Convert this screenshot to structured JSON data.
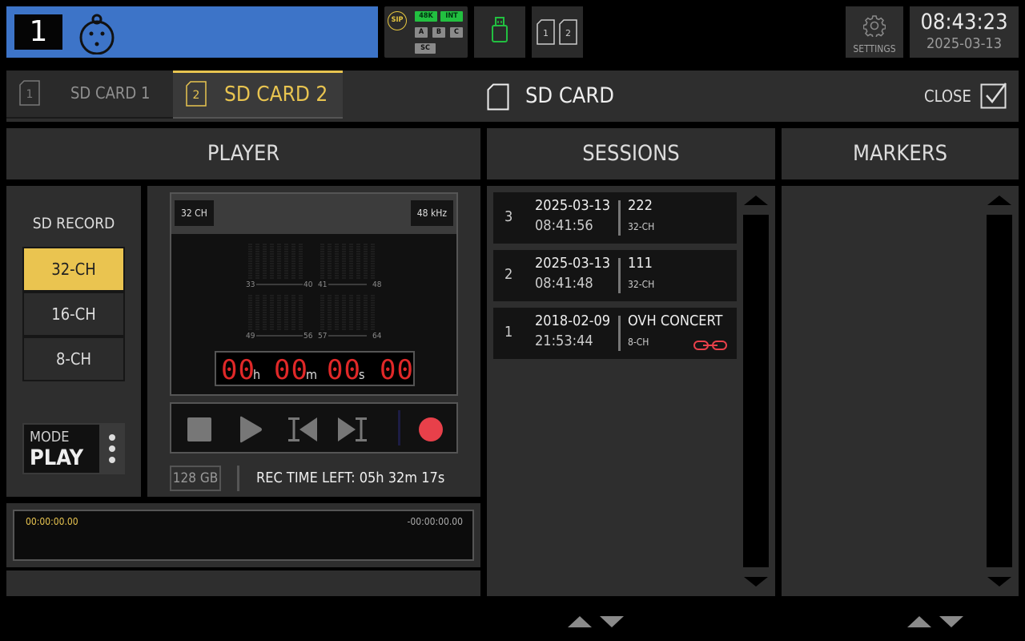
{
  "topbar": {
    "channel_number": "1",
    "status": {
      "sip": "SIP",
      "rate": "48K",
      "clock": "INT",
      "slots": [
        "A",
        "B",
        "C"
      ],
      "sc": "SC"
    },
    "sd_slots": [
      "1",
      "2"
    ],
    "settings_label": "SETTINGS",
    "clock_time": "08:43:23",
    "clock_date": "2025-03-13",
    "channel_color": "#3d74c8",
    "status_green": "#22c040"
  },
  "tabs": [
    {
      "number": "1",
      "label": "SD CARD 1",
      "active": false
    },
    {
      "number": "2",
      "label": "SD CARD 2",
      "active": true
    }
  ],
  "header": {
    "title": "SD CARD",
    "close_label": "CLOSE"
  },
  "sections": {
    "player": "PLAYER",
    "sessions": "SESSIONS",
    "markers": "MARKERS"
  },
  "record": {
    "title": "SD RECORD",
    "options": [
      "32-CH",
      "16-CH",
      "8-CH"
    ],
    "selected": "32-CH",
    "mode_label": "MODE",
    "mode_value": "PLAY",
    "accent": "#eac450"
  },
  "player": {
    "channels_tag": "32 CH",
    "rate_tag": "48 kHz",
    "meter_labels": {
      "b1_start": "33",
      "b1_end": "40",
      "b2_start": "41",
      "b2_end": "48",
      "b3_start": "49",
      "b3_end": "56",
      "b4_start": "57",
      "b4_end": "64"
    },
    "timecode": {
      "hours": "00",
      "minutes": "00",
      "seconds": "00",
      "frames": "00",
      "h": "h",
      "m": "m",
      "s": "s"
    },
    "transport": [
      "stop-icon",
      "play-icon",
      "previous-icon",
      "next-icon",
      "record-icon"
    ],
    "storage_size": "128 GB",
    "rec_time_left": "REC TIME LEFT:  05h 32m 17s",
    "record_color": "#e8404a"
  },
  "timeline": {
    "start": "00:00:00.00",
    "end": "-00:00:00.00"
  },
  "sessions": [
    {
      "index": "3",
      "date": "2025-03-13",
      "time": "08:41:56",
      "name": "222",
      "channels": "32-CH",
      "linked": false
    },
    {
      "index": "2",
      "date": "2025-03-13",
      "time": "08:41:48",
      "name": "111",
      "channels": "32-CH",
      "linked": false
    },
    {
      "index": "1",
      "date": "2018-02-09",
      "time": "21:53:44",
      "name": "OVH CONCERT",
      "channels": "8-CH",
      "linked": true
    }
  ]
}
